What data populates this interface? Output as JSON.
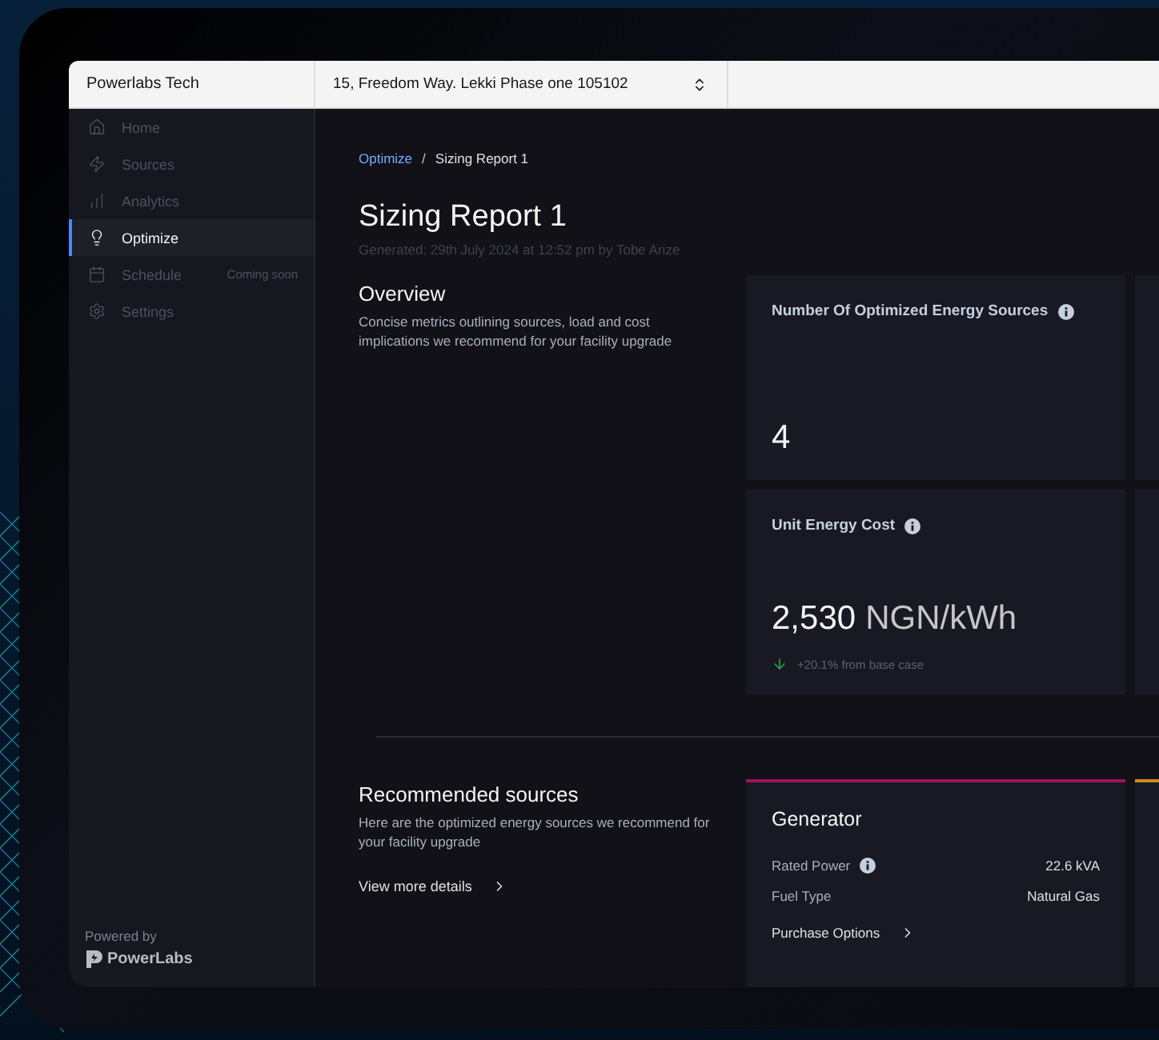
{
  "topbar": {
    "organization": "Powerlabs Tech",
    "address": "15, Freedom Way. Lekki Phase one 105102"
  },
  "sidebar": {
    "items": [
      {
        "label": "Home",
        "selected": false
      },
      {
        "label": "Sources",
        "selected": false
      },
      {
        "label": "Analytics",
        "selected": false
      },
      {
        "label": "Optimize",
        "selected": true
      },
      {
        "label": "Schedule",
        "selected": false,
        "badge": "Coming soon"
      },
      {
        "label": "Settings",
        "selected": false
      }
    ],
    "footer": {
      "powered_by": "Powered by",
      "brand": "PowerLabs"
    }
  },
  "breadcrumb_separator": "/",
  "breadcrumb": [
    {
      "label": "Optimize",
      "kind": "link"
    },
    {
      "label": "Sizing Report 1",
      "kind": "current"
    }
  ],
  "title": "Sizing Report 1",
  "subtitle": "Generated: 29th July 2024 at 12:52 pm by Tobe Arize",
  "overview": {
    "title": "Overview",
    "description": "Concise metrics outlining sources, load and cost implications we recommend for your facility upgrade",
    "metrics": [
      {
        "label": "Number Of Optimized Energy Sources",
        "value": "4"
      },
      {
        "label": "Unit Energy Cost",
        "value": "2,530",
        "unit": "NGN/kWh",
        "change": {
          "text": "+20.1% from base case",
          "falling": true
        }
      }
    ]
  },
  "recommended": {
    "title": "Recommended sources",
    "description": "Here are the optimized energy sources we recommend for your facility upgrade",
    "link": "View more details",
    "sources": [
      {
        "name": "Generator",
        "color": "#a1135e",
        "specs": [
          {
            "label": "Rated Power",
            "value": "22.6 kVA",
            "info": true
          },
          {
            "label": "Fuel Type",
            "value": "Natural Gas",
            "info": false
          }
        ],
        "action": "Purchase Options"
      },
      {
        "color": "#d08a20"
      }
    ]
  }
}
